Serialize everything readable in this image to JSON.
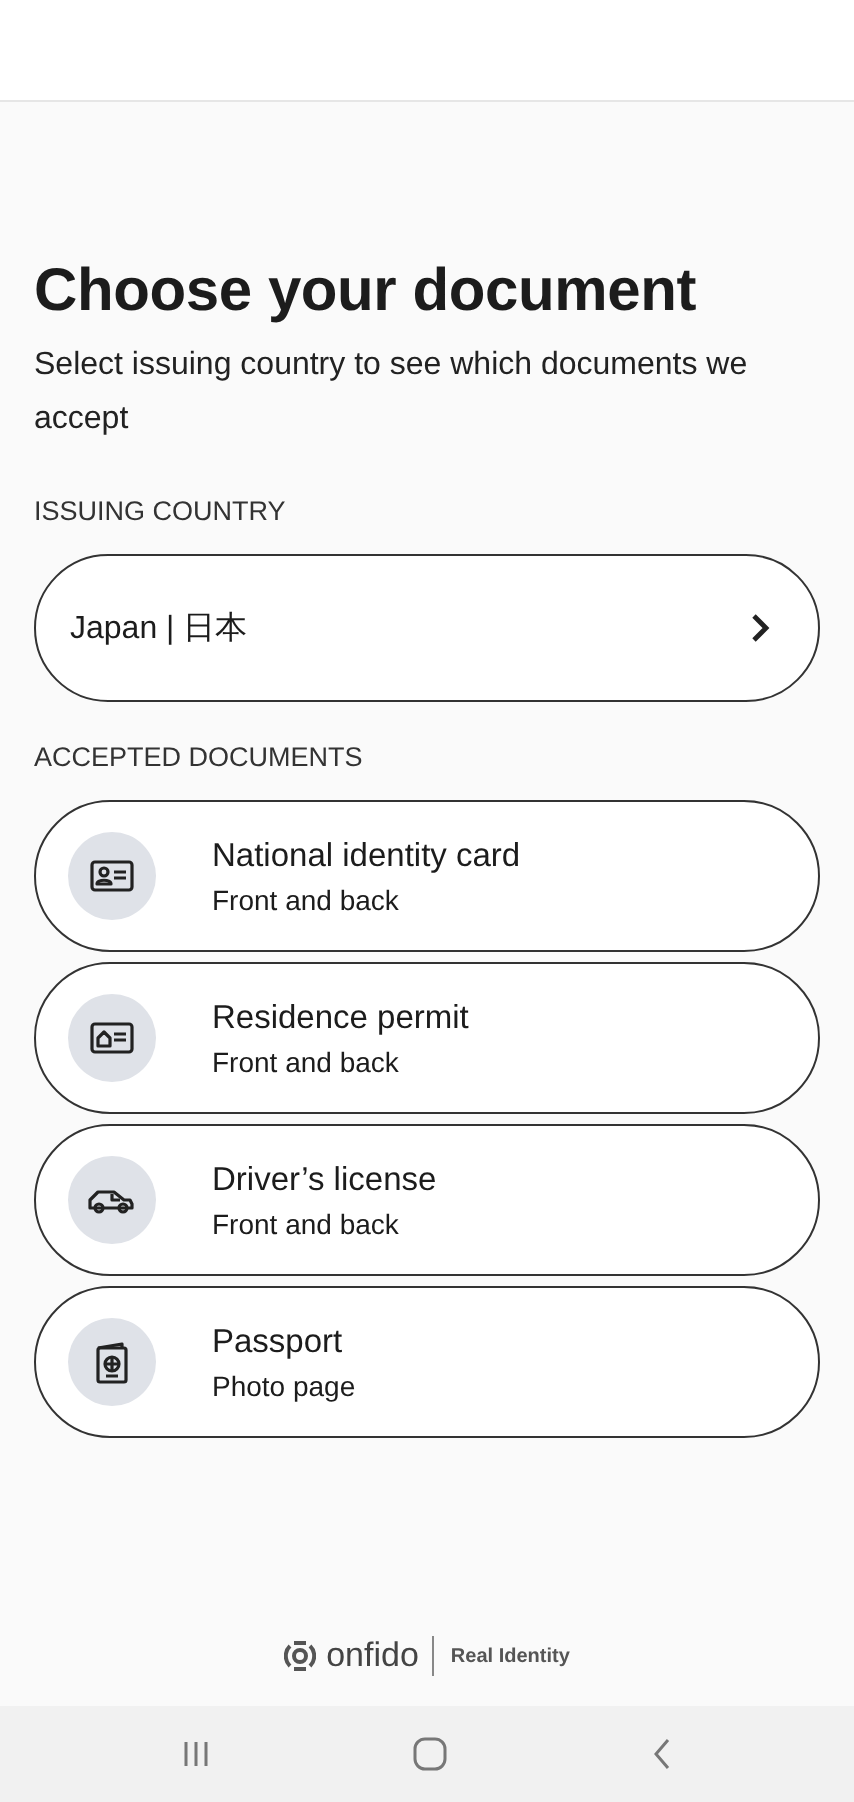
{
  "title": "Choose your document",
  "subtitle": "Select issuing country to see which documents we accept",
  "country_section": {
    "label": "ISSUING COUNTRY",
    "value": "Japan | 日本"
  },
  "documents_section": {
    "label": "ACCEPTED DOCUMENTS",
    "documents": [
      {
        "kind": "id-card",
        "name": "National identity card",
        "detail": "Front and back"
      },
      {
        "kind": "residence",
        "name": "Residence permit",
        "detail": "Front and back"
      },
      {
        "kind": "car",
        "name": "Driver’s license",
        "detail": "Front and back"
      },
      {
        "kind": "passport",
        "name": "Passport",
        "detail": "Photo page"
      }
    ]
  },
  "footer": {
    "brand": "onfido",
    "tagline": "Real Identity"
  }
}
